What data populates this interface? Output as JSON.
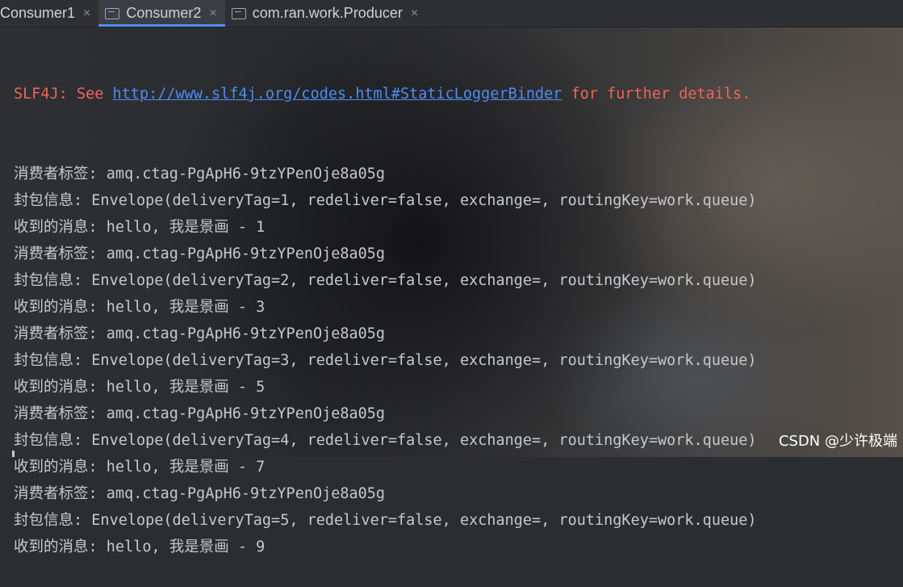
{
  "tabs": [
    {
      "label": "Consumer1",
      "close": "×",
      "active": false
    },
    {
      "label": "Consumer2",
      "close": "×",
      "active": true
    },
    {
      "label": "com.ran.work.Producer",
      "close": "×",
      "active": false
    }
  ],
  "console": {
    "slf4j": {
      "prefix": "SLF4J: See ",
      "link": "http://www.slf4j.org/codes.html#StaticLoggerBinder",
      "suffix": " for further details."
    },
    "lines": [
      {
        "label": "消费者标签",
        "sep": ": ",
        "value": "amq.ctag-PgApH6-9tzYPenOje8a05g"
      },
      {
        "label": "封包信息",
        "sep": ": ",
        "value": "Envelope(deliveryTag=1, redeliver=false, exchange=, routingKey=work.queue)"
      },
      {
        "label": "收到的消息",
        "sep": ": ",
        "value": "hello, 我是景画 - 1"
      },
      {
        "label": "消费者标签",
        "sep": ": ",
        "value": "amq.ctag-PgApH6-9tzYPenOje8a05g"
      },
      {
        "label": "封包信息",
        "sep": ": ",
        "value": "Envelope(deliveryTag=2, redeliver=false, exchange=, routingKey=work.queue)"
      },
      {
        "label": "收到的消息",
        "sep": ": ",
        "value": "hello, 我是景画 - 3"
      },
      {
        "label": "消费者标签",
        "sep": ": ",
        "value": "amq.ctag-PgApH6-9tzYPenOje8a05g"
      },
      {
        "label": "封包信息",
        "sep": ": ",
        "value": "Envelope(deliveryTag=3, redeliver=false, exchange=, routingKey=work.queue)"
      },
      {
        "label": "收到的消息",
        "sep": ": ",
        "value": "hello, 我是景画 - 5"
      },
      {
        "label": "消费者标签",
        "sep": ": ",
        "value": "amq.ctag-PgApH6-9tzYPenOje8a05g"
      },
      {
        "label": "封包信息",
        "sep": ": ",
        "value": "Envelope(deliveryTag=4, redeliver=false, exchange=, routingKey=work.queue)"
      },
      {
        "label": "收到的消息",
        "sep": ": ",
        "value": "hello, 我是景画 - 7"
      },
      {
        "label": "消费者标签",
        "sep": ": ",
        "value": "amq.ctag-PgApH6-9tzYPenOje8a05g"
      },
      {
        "label": "封包信息",
        "sep": ": ",
        "value": "Envelope(deliveryTag=5, redeliver=false, exchange=, routingKey=work.queue)"
      },
      {
        "label": "收到的消息",
        "sep": ": ",
        "value": "hello, 我是景画 - 9"
      }
    ]
  },
  "watermark": "CSDN @少许极端",
  "colors": {
    "error": "#f0645a",
    "link": "#4d8df2",
    "text": "#c6c9cc",
    "active_tab_underline": "#4f8ef7"
  }
}
